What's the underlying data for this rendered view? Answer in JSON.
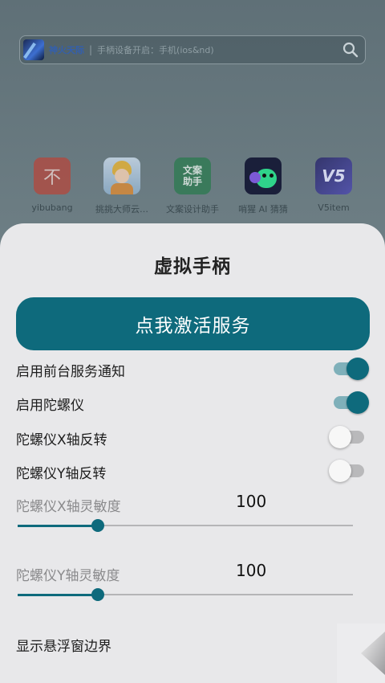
{
  "launcher": {
    "search": {
      "brand": "神火天际",
      "separator": "|",
      "placeholder": "手柄设备开启：手机(ios&nd)",
      "icon": "search-icon"
    },
    "apps": [
      {
        "label": "yibubang",
        "icon": "bu-icon",
        "icon_glyph": "不",
        "color": "#b5473c"
      },
      {
        "label": "挑挑大师云…",
        "icon": "girl-avatar-icon",
        "color": "#d9a24a"
      },
      {
        "label": "文案设计助手",
        "icon": "copywriting-icon",
        "icon_glyph": "文案\n助手",
        "color": "#2f7a52"
      },
      {
        "label": "哨猩 AI 猜猜",
        "icon": "monster-icon",
        "color": "#1a1f3a"
      },
      {
        "label": "V5item",
        "icon": "v5-icon",
        "icon_glyph": "V5",
        "color": "#3b3a8a"
      }
    ]
  },
  "sheet": {
    "title": "虚拟手柄",
    "activate_button": "点我激活服务",
    "toggles": [
      {
        "label": "启用前台服务通知",
        "on": true
      },
      {
        "label": "启用陀螺仪",
        "on": true
      },
      {
        "label": "陀螺仪X轴反转",
        "on": false
      },
      {
        "label": "陀螺仪Y轴反转",
        "on": false
      }
    ],
    "sliders": [
      {
        "label": "陀螺仪X轴灵敏度",
        "value": "100",
        "fraction": 0.24
      },
      {
        "label": "陀螺仪Y轴灵敏度",
        "value": "100",
        "fraction": 0.24
      }
    ],
    "show_edge_label": "显示悬浮窗边界"
  },
  "colors": {
    "accent": "#0e6a7c",
    "sheet_bg": "#e8e8ea"
  }
}
